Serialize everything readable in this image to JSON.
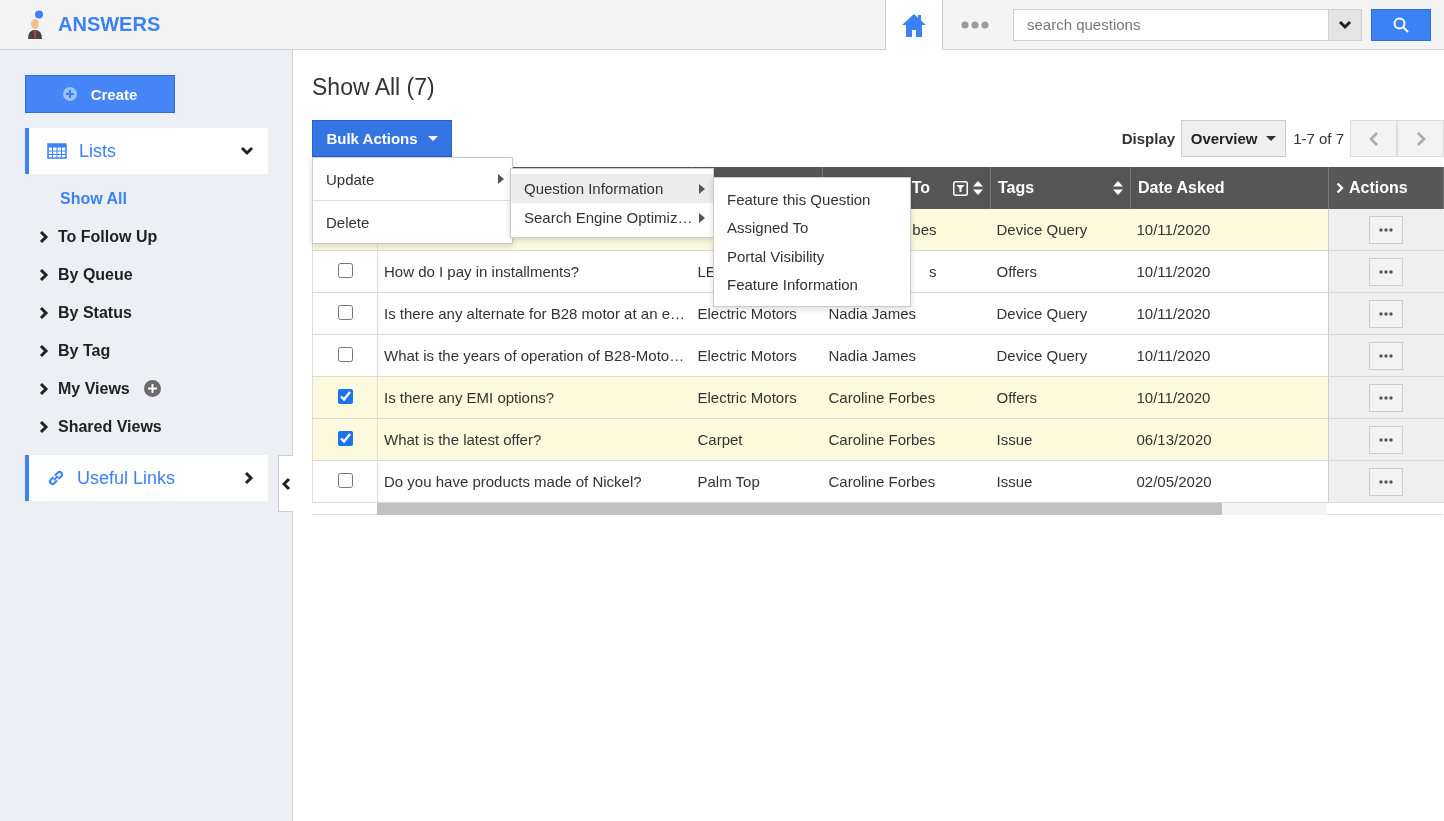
{
  "app": {
    "name": "ANSWERS"
  },
  "search": {
    "placeholder": "search questions"
  },
  "sidebar": {
    "create_label": "Create",
    "sections": [
      {
        "label": "Lists",
        "kind": "lists",
        "expanded": true,
        "items": [
          {
            "label": "Show All",
            "kind": "leaf",
            "selected": true
          },
          {
            "label": "To Follow Up",
            "kind": "group",
            "selected": false
          },
          {
            "label": "By Queue",
            "kind": "group",
            "selected": false
          },
          {
            "label": "By Status",
            "kind": "group",
            "selected": false
          },
          {
            "label": "By Tag",
            "kind": "group",
            "selected": false
          },
          {
            "label": "My Views",
            "kind": "group",
            "selected": false,
            "addable": true
          },
          {
            "label": "Shared Views",
            "kind": "group",
            "selected": false
          }
        ]
      },
      {
        "label": "Useful Links",
        "kind": "links",
        "expanded": false
      }
    ]
  },
  "page": {
    "title": "Show All (7)"
  },
  "toolbar": {
    "bulk_label": "Bulk Actions",
    "display_label": "Display",
    "display_value": "Overview",
    "paging": "1-7 of 7"
  },
  "bulk_menu": [
    {
      "label": "Update",
      "submenu": true,
      "selected": false
    },
    {
      "label": "Delete",
      "submenu": false,
      "selected": false
    }
  ],
  "update_menu": [
    {
      "label": "Question Information",
      "submenu": true,
      "selected": true
    },
    {
      "label": "Search Engine Optimiz…",
      "submenu": true,
      "selected": false
    }
  ],
  "info_menu": [
    {
      "label": "Feature this Question",
      "selected": false
    },
    {
      "label": "Assigned To",
      "selected": false
    },
    {
      "label": "Portal Visibility",
      "selected": false
    },
    {
      "label": "Feature Information",
      "selected": false
    }
  ],
  "table": {
    "columns": [
      {},
      {},
      {
        "label": "To",
        "clipped": true,
        "filter": true,
        "sortable": true
      },
      {
        "label": "Tags",
        "sortable": true
      },
      {
        "label": "Date Asked"
      },
      {
        "label": "Actions",
        "expander": true
      }
    ],
    "rows": [
      {
        "selected": true,
        "cells": [
          {},
          {},
          {
            "text": "bes",
            "clipped": true
          },
          {
            "text": "Device Query"
          },
          {
            "text": "10/11/2020"
          }
        ]
      },
      {
        "selected": false,
        "cells": [
          {
            "text": "How do I pay in installments?"
          },
          {
            "text": "LE"
          },
          {
            "text": "s",
            "clipped": true
          },
          {
            "text": "Offers"
          },
          {
            "text": "10/11/2020"
          }
        ]
      },
      {
        "selected": false,
        "cells": [
          {
            "text": "Is there any alternate for B28 motor at an e…"
          },
          {
            "text": "Electric Motors"
          },
          {
            "text": "Nadia James"
          },
          {
            "text": "Device Query"
          },
          {
            "text": "10/11/2020"
          }
        ]
      },
      {
        "selected": false,
        "cells": [
          {
            "text": "What is the years of operation of B28-Moto…"
          },
          {
            "text": "Electric Motors"
          },
          {
            "text": "Nadia James"
          },
          {
            "text": "Device Query"
          },
          {
            "text": "10/11/2020"
          }
        ]
      },
      {
        "selected": true,
        "cells": [
          {
            "text": "Is there any EMI options?"
          },
          {
            "text": "Electric Motors"
          },
          {
            "text": "Caroline Forbes"
          },
          {
            "text": "Offers"
          },
          {
            "text": "10/11/2020"
          }
        ]
      },
      {
        "selected": true,
        "cells": [
          {
            "text": "What is the latest offer?"
          },
          {
            "text": "Carpet"
          },
          {
            "text": "Caroline Forbes"
          },
          {
            "text": "Issue"
          },
          {
            "text": "06/13/2020"
          }
        ]
      },
      {
        "selected": false,
        "cells": [
          {
            "text": "Do you have products made of Nickel?"
          },
          {
            "text": "Palm Top"
          },
          {
            "text": "Caroline Forbes"
          },
          {
            "text": "Issue"
          },
          {
            "text": "02/05/2020"
          }
        ]
      }
    ]
  }
}
